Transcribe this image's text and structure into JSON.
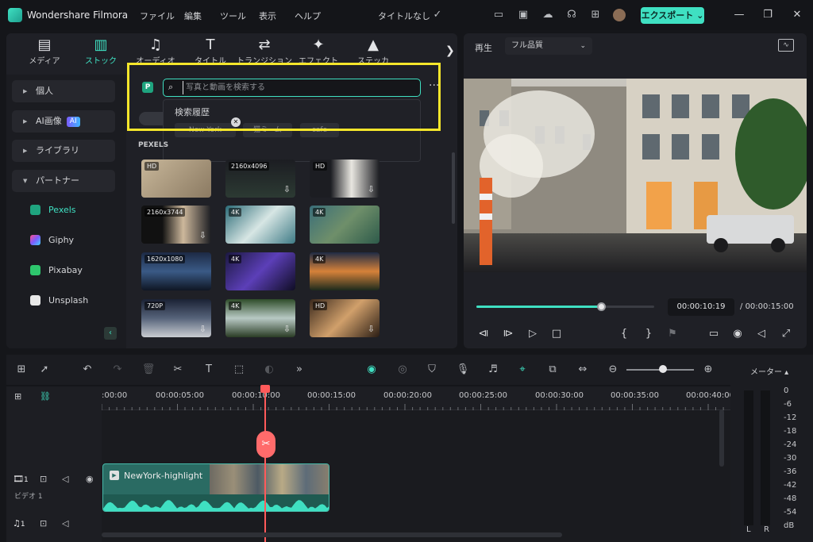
{
  "app": {
    "name": "Wondershare Filmora",
    "menu": [
      "ファイル",
      "編集",
      "ツール",
      "表示",
      "ヘルプ"
    ],
    "project_name": "タイトルなし",
    "export_label": "エクスポート"
  },
  "media_tabs": [
    {
      "label": "メディア",
      "icon": "media-icon"
    },
    {
      "label": "ストック",
      "icon": "stock-icon"
    },
    {
      "label": "オーディオ",
      "icon": "audio-icon"
    },
    {
      "label": "タイトル",
      "icon": "title-icon"
    },
    {
      "label": "トランジション",
      "icon": "transition-icon"
    },
    {
      "label": "エフェクト",
      "icon": "effect-icon"
    },
    {
      "label": "ステッカ",
      "icon": "sticker-icon"
    }
  ],
  "sidebar": {
    "items": [
      "個人",
      "AI画像",
      "ライブラリ",
      "パートナー"
    ],
    "ai_badge": "AI",
    "partners": [
      "Pexels",
      "Giphy",
      "Pixabay",
      "Unsplash"
    ]
  },
  "search": {
    "placeholder": "写真と動画を検索する",
    "history_title": "検索履歴",
    "history_items": [
      "New York",
      "猫ミーム",
      "cafe"
    ]
  },
  "content": {
    "section_label": "PEXELS",
    "thumbnails": [
      {
        "tag": "HD"
      },
      {
        "tag": "2160x4096"
      },
      {
        "tag": "HD"
      },
      {
        "tag": "2160x3744"
      },
      {
        "tag": "4K"
      },
      {
        "tag": "4K"
      },
      {
        "tag": "1620x1080"
      },
      {
        "tag": "4K"
      },
      {
        "tag": "4K"
      },
      {
        "tag": "720P"
      },
      {
        "tag": "4K"
      },
      {
        "tag": "HD"
      }
    ]
  },
  "preview": {
    "label": "再生",
    "quality": "フル品質",
    "current_time": "00:00:10:19",
    "total_time": "00:00:15:00",
    "progress": 0.7
  },
  "timeline": {
    "ruler": [
      ":00:00",
      "00:00:05:00",
      "00:00:10:00",
      "00:00:15:00",
      "00:00:20:00",
      "00:00:25:00",
      "00:00:30:00",
      "00:00:35:00",
      "00:00:40:00"
    ],
    "video_track_label": "ビデオ 1",
    "video_track_num": "1",
    "audio_track_num": "1",
    "clip_name": "NewYork-highlight"
  },
  "meter": {
    "title": "メーター",
    "scale": [
      "0",
      "-6",
      "-12",
      "-18",
      "-24",
      "-30",
      "-36",
      "-42",
      "-48",
      "-54",
      "dB"
    ],
    "channels": [
      "L",
      "R"
    ]
  },
  "colors": {
    "accent": "#3fe0c2",
    "playhead": "#ff5a5a",
    "highlight": "#f5e62b"
  }
}
